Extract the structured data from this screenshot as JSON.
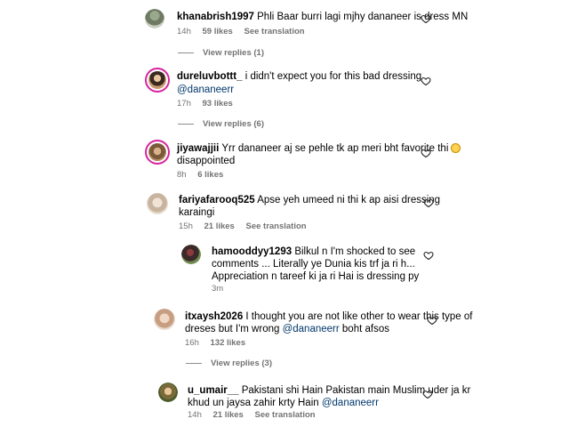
{
  "comments": [
    {
      "username": "khanabrish1997",
      "text": "Phli Baar burri lagi mjhy dananeer is dress MN",
      "time": "14h",
      "likes": "59 likes",
      "translation": "See translation",
      "view_replies": "View replies (1)"
    },
    {
      "username": "dureluvbottt_",
      "text": "i didn't expect you for this bad dressing",
      "mention": "@dananeerr",
      "time": "17h",
      "likes": "93 likes",
      "view_replies": "View replies (6)"
    },
    {
      "username": "jiyawajjii",
      "text_line1": "Yrr dananeer aj se pehle tk ap meri bht favorite thi",
      "emoji": "confused-face-emoji",
      "text_line2": "disappointed",
      "time": "8h",
      "likes": "6 likes"
    },
    {
      "username": "fariyafarooq525",
      "text_line1": "Apse yeh umeed ni thi k ap aisi dressing",
      "text_line2": "karaingi",
      "time": "15h",
      "likes": "21 likes",
      "translation": "See translation"
    },
    {
      "username": "hamooddyy1293",
      "text_line1": "Bilkul n I'm shocked to see",
      "text_line2": "comments ... Literally ye Dunia kis trf ja ri h...",
      "text_line3": "Appreciation n tareef ki ja ri Hai is dressing py",
      "time": "3m"
    },
    {
      "username": "itxaysh2026",
      "text_line1": "I thought you are not like other to wear this type of",
      "text_line2_pre": "dreses but I'm wrong",
      "mention": "@dananeerr",
      "text_line2_post": "boht afsos",
      "time": "16h",
      "likes": "132 likes",
      "view_replies": "View replies (3)"
    },
    {
      "username": "u_umair__",
      "text_line1": "Pakistani shi Hain Pakistan main Muslim uder ja kr",
      "text_line2": "khud un jaysa zahir krty Hain",
      "mention": "@dananeerr",
      "time": "14h",
      "likes": "21 likes",
      "translation": "See translation"
    }
  ],
  "colors": {
    "story_ring": "#d6249f",
    "meta_gray": "#737373",
    "mention_blue": "#00376b"
  }
}
